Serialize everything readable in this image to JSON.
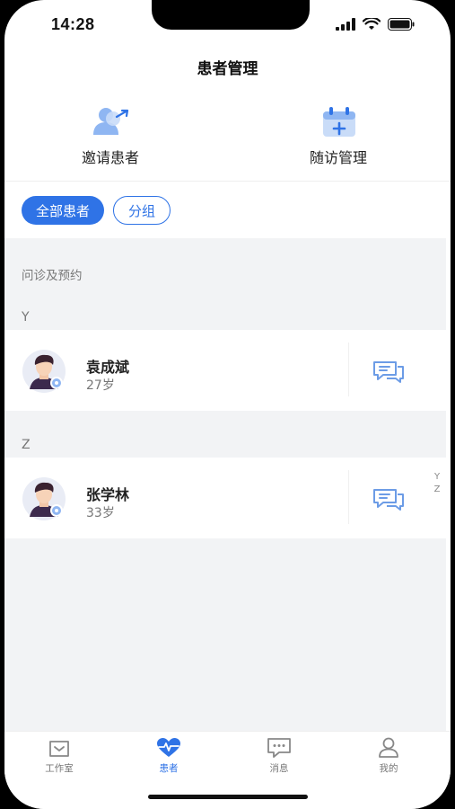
{
  "status_bar": {
    "time": "14:28"
  },
  "page_title": "患者管理",
  "quick_actions": [
    {
      "label": "邀请患者",
      "icon": "invite-patient-icon"
    },
    {
      "label": "随访管理",
      "icon": "followup-icon"
    }
  ],
  "filters": [
    {
      "label": "全部患者",
      "active": true
    },
    {
      "label": "分组",
      "active": false
    }
  ],
  "sections": {
    "consult": "问诊及预约",
    "groups": [
      {
        "letter": "Y",
        "patients": [
          {
            "name": "袁成斌",
            "age": "27岁"
          }
        ]
      },
      {
        "letter": "Z",
        "patients": [
          {
            "name": "张学林",
            "age": "33岁"
          }
        ]
      }
    ]
  },
  "index_bar": [
    "Y",
    "Z"
  ],
  "tabbar": [
    {
      "label": "工作室",
      "icon": "studio-icon",
      "active": false
    },
    {
      "label": "患者",
      "icon": "heartbeat-icon",
      "active": true
    },
    {
      "label": "消息",
      "icon": "message-icon",
      "active": false
    },
    {
      "label": "我的",
      "icon": "profile-icon",
      "active": false
    }
  ],
  "colors": {
    "accent": "#2f73e6",
    "list_bg": "#f2f3f5",
    "icon_light": "#8fb6f2"
  }
}
